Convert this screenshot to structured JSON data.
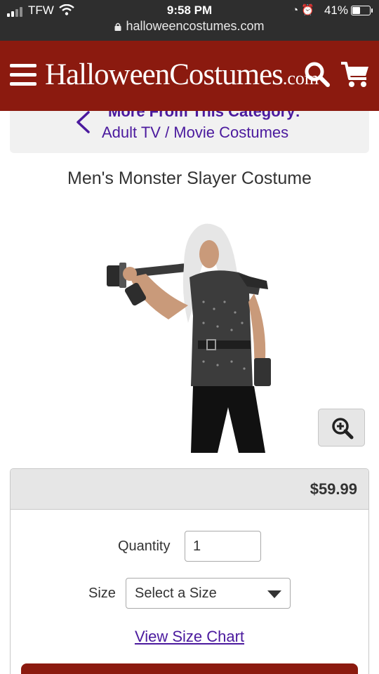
{
  "status_bar": {
    "carrier": "TFW",
    "time": "9:58 PM",
    "battery_percent": "41%",
    "battery_level": 0.41,
    "url": "halloweencostumes.com"
  },
  "header": {
    "logo_main": "HalloweenCostumes",
    "logo_suffix": ".com",
    "menu_icon": "hamburger-menu-icon",
    "search_icon": "search-icon",
    "cart_icon": "shopping-cart-icon",
    "brand_color": "#8b1a0f"
  },
  "category": {
    "more_label": "More From This Category:",
    "link_label": "Adult TV / Movie Costumes",
    "link_color": "#4b1a9e"
  },
  "product": {
    "title": "Men's Monster Slayer Costume",
    "price": "$59.99",
    "zoom_icon": "zoom-in-icon"
  },
  "form": {
    "quantity_label": "Quantity",
    "quantity_value": "1",
    "size_label": "Size",
    "size_selected": "Select a Size",
    "size_chart_link": "View Size Chart"
  }
}
